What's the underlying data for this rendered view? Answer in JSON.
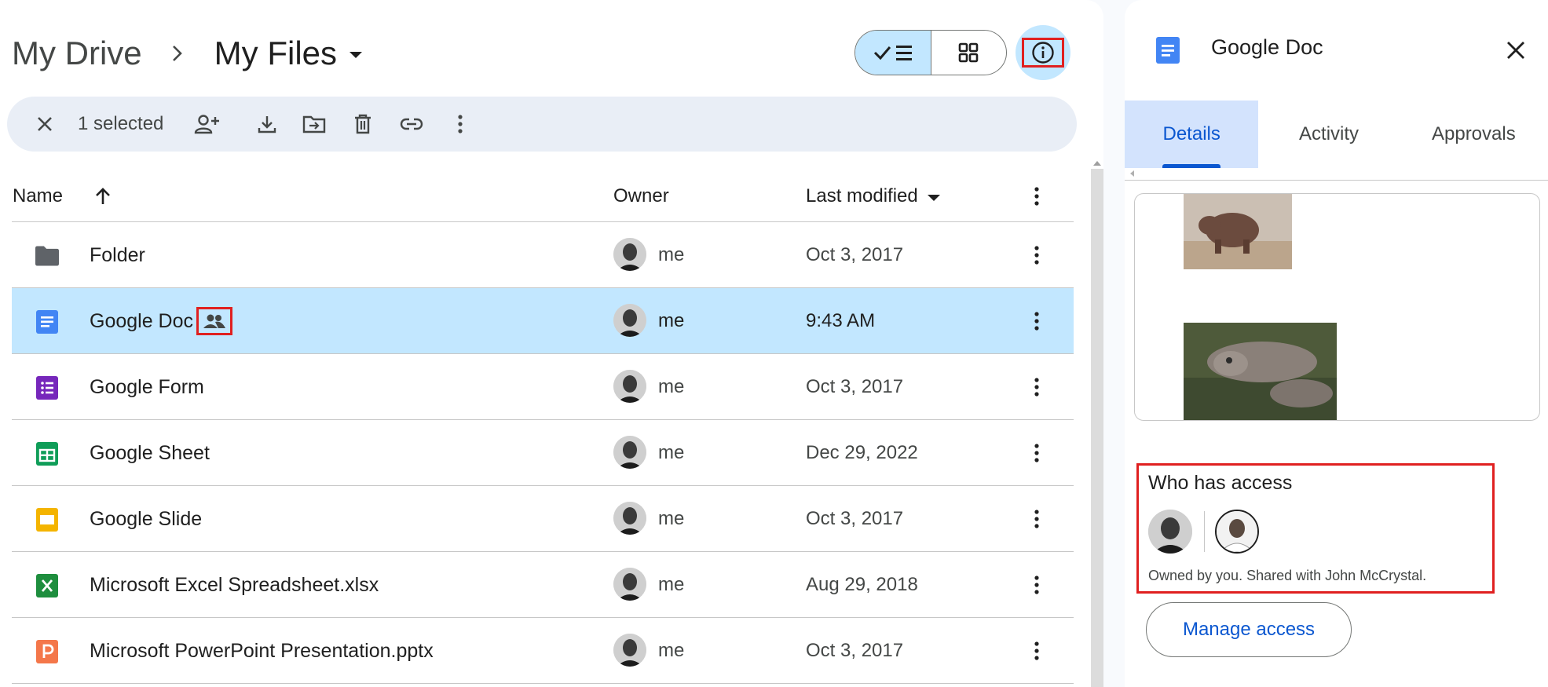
{
  "breadcrumb": {
    "root": "My Drive",
    "current": "My Files"
  },
  "view_toggle": {
    "list_icon": "check-list-icon",
    "grid_icon": "grid-icon"
  },
  "info_button": {
    "icon": "info-icon"
  },
  "selection_bar": {
    "count_label": "1 selected",
    "actions": [
      "close-icon",
      "share-person-add-icon",
      "download-icon",
      "move-to-folder-icon",
      "trash-icon",
      "link-icon",
      "more-vertical-icon"
    ]
  },
  "table": {
    "headers": {
      "name": "Name",
      "owner": "Owner",
      "modified": "Last modified"
    },
    "rows": [
      {
        "name": "Folder",
        "type": "folder",
        "owner": "me",
        "modified": "Oct 3, 2017",
        "selected": false,
        "shared": false
      },
      {
        "name": "Google Doc",
        "type": "doc",
        "owner": "me",
        "modified": "9:43 AM",
        "selected": true,
        "shared": true
      },
      {
        "name": "Google Form",
        "type": "form",
        "owner": "me",
        "modified": "Oct 3, 2017",
        "selected": false,
        "shared": false
      },
      {
        "name": "Google Sheet",
        "type": "sheet",
        "owner": "me",
        "modified": "Dec 29, 2022",
        "selected": false,
        "shared": false
      },
      {
        "name": "Google Slide",
        "type": "slide",
        "owner": "me",
        "modified": "Oct 3, 2017",
        "selected": false,
        "shared": false
      },
      {
        "name": "Microsoft Excel Spreadsheet.xlsx",
        "type": "excel",
        "owner": "me",
        "modified": "Aug 29, 2018",
        "selected": false,
        "shared": false
      },
      {
        "name": "Microsoft PowerPoint Presentation.pptx",
        "type": "powerpoint",
        "owner": "me",
        "modified": "Oct 3, 2017",
        "selected": false,
        "shared": false
      }
    ]
  },
  "details_panel": {
    "title": "Google Doc",
    "tabs": [
      "Details",
      "Activity",
      "Approvals"
    ],
    "active_tab": "Details",
    "access": {
      "title": "Who has access",
      "description": "Owned by you. Shared with John McCrystal."
    },
    "manage_button": "Manage access"
  },
  "colors": {
    "selected_row": "#c2e7ff",
    "accent_blue": "#0b57d0",
    "highlight_red": "#e02020",
    "doc_blue": "#4285f4",
    "form_purple": "#7627bb",
    "sheet_green": "#0f9d58",
    "slide_yellow": "#f4b400",
    "excel_green": "#1e8e3e",
    "ppt_orange": "#f4774a"
  }
}
